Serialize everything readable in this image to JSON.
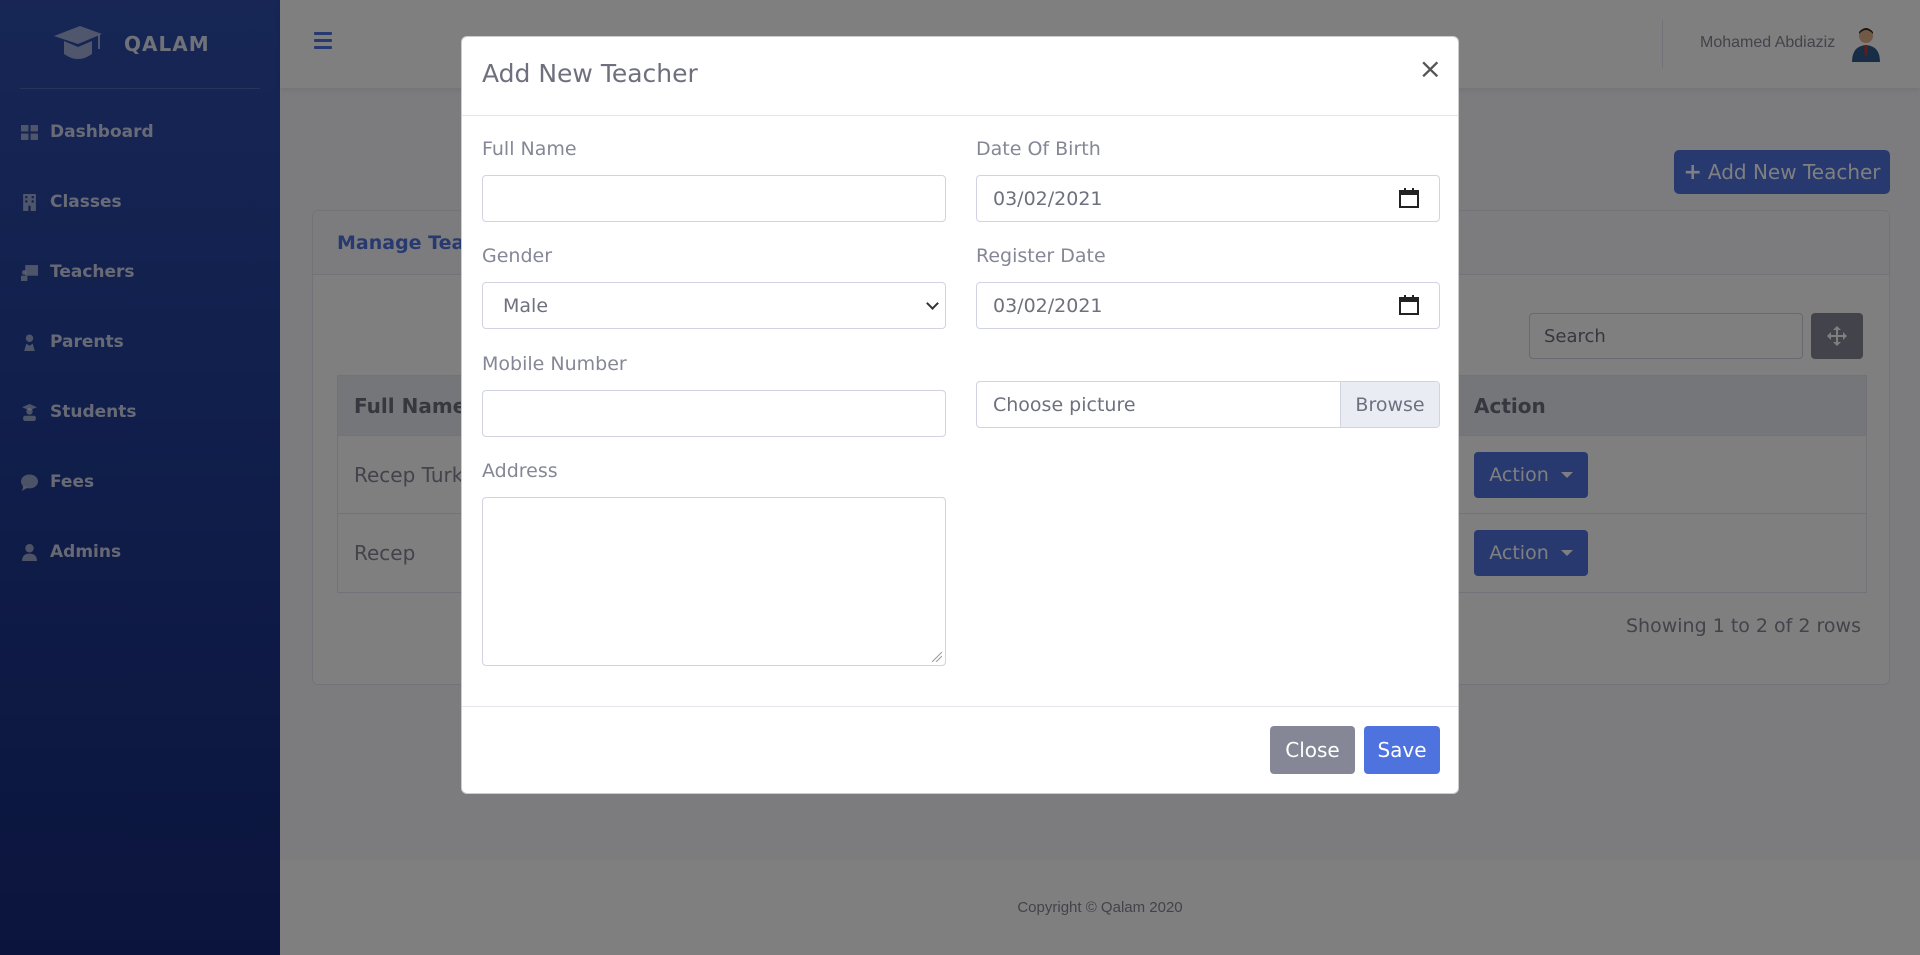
{
  "brand": {
    "name": "QALAM"
  },
  "sidebar": {
    "items": [
      {
        "label": "Dashboard",
        "icon": "dashboard-icon"
      },
      {
        "label": "Classes",
        "icon": "building-icon"
      },
      {
        "label": "Teachers",
        "icon": "chalkboard-teacher-icon"
      },
      {
        "label": "Parents",
        "icon": "user-tie-icon"
      },
      {
        "label": "Students",
        "icon": "user-graduate-icon"
      },
      {
        "label": "Fees",
        "icon": "comment-dollar-icon"
      },
      {
        "label": "Admins",
        "icon": "user-icon"
      }
    ]
  },
  "topbar": {
    "username": "Mohamed Abdiaziz"
  },
  "page": {
    "add_button_label": "Add New Teacher",
    "card_title": "Manage Teachers",
    "search_placeholder": "Search",
    "table": {
      "headers": {
        "name": "Full Name",
        "action": "Action"
      },
      "rows": [
        {
          "name": "Recep Turk",
          "action_label": "Action"
        },
        {
          "name": "Recep",
          "action_label": "Action"
        }
      ]
    },
    "showing_text": "Showing 1 to 2 of 2 rows"
  },
  "footer": {
    "text": "Copyright © Qalam 2020"
  },
  "modal": {
    "title": "Add New Teacher",
    "close_symbol": "×",
    "fields": {
      "full_name": {
        "label": "Full Name",
        "value": ""
      },
      "date_of_birth": {
        "label": "Date Of Birth",
        "value": "03/02/2021"
      },
      "gender": {
        "label": "Gender",
        "value": "Male"
      },
      "register_date": {
        "label": "Register Date",
        "value": "03/02/2021"
      },
      "mobile_number": {
        "label": "Mobile Number",
        "value": ""
      },
      "picture": {
        "placeholder": "Choose picture",
        "browse_label": "Browse"
      },
      "address": {
        "label": "Address",
        "value": ""
      }
    },
    "buttons": {
      "close": "Close",
      "save": "Save"
    }
  },
  "colors": {
    "primary": "#4e73df",
    "secondary": "#858796",
    "sidebar_top": "#2e4dab",
    "sidebar_bottom": "#16297a"
  }
}
